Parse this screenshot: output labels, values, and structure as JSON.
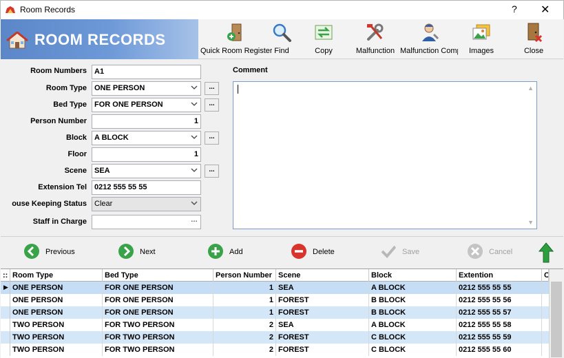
{
  "window": {
    "title": "Room Records",
    "help": "?",
    "close": "✕"
  },
  "banner": {
    "title": "ROOM RECORDS"
  },
  "toolbar": [
    {
      "label": "Quick Room Register",
      "icon": "door-plus-icon"
    },
    {
      "label": "Find",
      "icon": "magnifier-icon"
    },
    {
      "label": "Copy",
      "icon": "copy-arrows-icon"
    },
    {
      "label": "Malfunction",
      "icon": "tools-icon"
    },
    {
      "label": "Malfunction Comp",
      "icon": "technician-icon"
    },
    {
      "label": "Images",
      "icon": "images-icon"
    },
    {
      "label": "Close",
      "icon": "exit-door-icon"
    }
  ],
  "form": {
    "room_numbers": {
      "label": "Room Numbers",
      "value": "A1"
    },
    "room_type": {
      "label": "Room Type",
      "value": "ONE PERSON"
    },
    "bed_type": {
      "label": "Bed Type",
      "value": "FOR ONE PERSON"
    },
    "person_number": {
      "label": "Person Number",
      "value": "1"
    },
    "block": {
      "label": "Block",
      "value": "A BLOCK"
    },
    "floor": {
      "label": "Floor",
      "value": "1"
    },
    "scene": {
      "label": "Scene",
      "value": "SEA"
    },
    "extension_tel": {
      "label": "Extension Tel",
      "value": "0212 555 55 55"
    },
    "house_keeping": {
      "label": "ouse Keeping Status",
      "value": "Clear"
    },
    "staff": {
      "label": "Staff in Charge",
      "value": ""
    },
    "ellipsis": "...",
    "comment_label": "Comment"
  },
  "nav": {
    "previous": "Previous",
    "next": "Next",
    "add": "Add",
    "delete": "Delete",
    "save": "Save",
    "cancel": "Cancel"
  },
  "grid": {
    "columns": [
      "Room Type",
      "Bed Type",
      "Person Number",
      "Scene",
      "Block",
      "Extention",
      "C"
    ],
    "rows": [
      [
        "ONE PERSON",
        "FOR ONE PERSON",
        "1",
        "SEA",
        "A BLOCK",
        "0212 555 55 55"
      ],
      [
        "ONE PERSON",
        "FOR ONE PERSON",
        "1",
        "FOREST",
        "B BLOCK",
        "0212 555 55 56"
      ],
      [
        "ONE PERSON",
        "FOR ONE PERSON",
        "1",
        "FOREST",
        "B BLOCK",
        "0212 555 55 57"
      ],
      [
        "TWO PERSON",
        "FOR TWO PERSON",
        "2",
        "SEA",
        "A BLOCK",
        "0212 555 55 58"
      ],
      [
        "TWO PERSON",
        "FOR TWO PERSON",
        "2",
        "FOREST",
        "C BLOCK",
        "0212 555 55 59"
      ],
      [
        "TWO PERSON",
        "FOR TWO PERSON",
        "2",
        "FOREST",
        "C BLOCK",
        "0212 555 55 60"
      ]
    ]
  },
  "colors": {
    "banner": "#5b86c8",
    "row_alt": "#d4e7f8",
    "green": "#3aa34a",
    "red": "#d9342b"
  }
}
